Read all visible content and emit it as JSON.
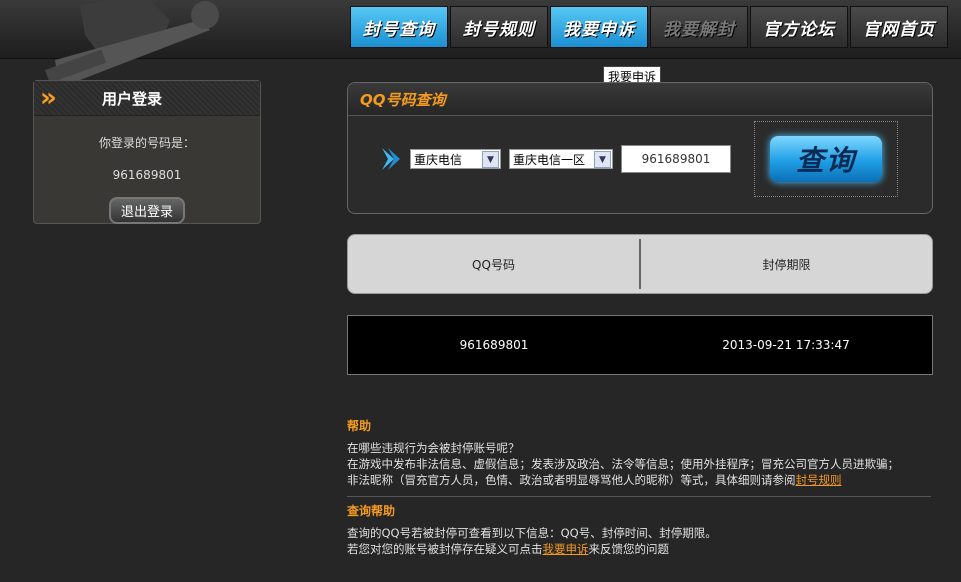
{
  "nav": {
    "items": [
      {
        "label": "封号查询"
      },
      {
        "label": "封号规则"
      },
      {
        "label": "我要申诉"
      },
      {
        "label": "我要解封"
      },
      {
        "label": "官方论坛"
      },
      {
        "label": "官网首页"
      }
    ],
    "tooltip": "我要申诉"
  },
  "login": {
    "title": "用户登录",
    "label": "你登录的号码是：",
    "qq": "961689801",
    "logout_label": "退出登录"
  },
  "query": {
    "title": "QQ号码查询",
    "isp_select": "重庆电信",
    "region_select": "重庆电信一区",
    "qq_value": "961689801",
    "button_label": "查询"
  },
  "results": {
    "headers": [
      "QQ号码",
      "封停期限"
    ],
    "rows": [
      {
        "qq": "961689801",
        "until": "2013-09-21 17:33:47"
      }
    ]
  },
  "help": {
    "title": "帮助",
    "q": "在哪些违规行为会被封停账号呢？",
    "line1": "在游戏中发布非法信息、虚假信息；发表涉及政治、法令等信息；使用外挂程序；冒充公司官方人员进欺骗；",
    "line2_prefix": "非法昵称（冒充官方人员，色情、政治或者明显辱骂他人的昵称）等式，具体细则请参阅",
    "line2_link": "封号规则",
    "title2": "查询帮助",
    "line3": "查询的QQ号若被封停可查看到以下信息：QQ号、封停时间、封停期限。",
    "line4_prefix": "若您对您的账号被封停存在疑义可点击",
    "line4_link": "我要申诉",
    "line4_suffix": "来反馈您的问题"
  }
}
